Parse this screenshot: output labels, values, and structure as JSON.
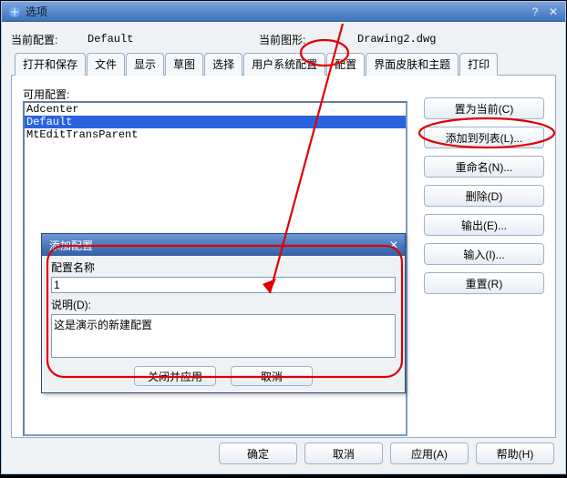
{
  "window": {
    "title": "选项",
    "help_glyph": "?",
    "close_glyph": "✕"
  },
  "info": {
    "current_profile_label": "当前配置:",
    "current_profile_value": "Default",
    "current_drawing_label": "当前图形:",
    "current_drawing_value": "Drawing2.dwg"
  },
  "tabs": {
    "items": [
      {
        "label": "打开和保存"
      },
      {
        "label": "文件"
      },
      {
        "label": "显示"
      },
      {
        "label": "草图"
      },
      {
        "label": "选择"
      },
      {
        "label": "用户系统配置"
      },
      {
        "label": "配置"
      },
      {
        "label": "界面皮肤和主题"
      },
      {
        "label": "打印"
      }
    ],
    "active_index": 6
  },
  "page": {
    "available_label": "可用配置:",
    "list": [
      "Adcenter",
      "Default",
      "MtEditTransParent"
    ],
    "selected_index": 1
  },
  "buttons": {
    "set_current": "置为当前(C)",
    "add_to_list": "添加到列表(L)...",
    "rename": "重命名(N)...",
    "delete": "删除(D)",
    "export": "输出(E)...",
    "import": "输入(I)...",
    "reset": "重置(R)"
  },
  "footer": {
    "ok": "确定",
    "cancel": "取消",
    "apply": "应用(A)",
    "help": "帮助(H)"
  },
  "modal": {
    "title": "添加配置",
    "name_label": "配置名称",
    "name_value": "1",
    "desc_label": "说明(D):",
    "desc_value": "这是演示的新建配置",
    "close_apply": "关闭并应用",
    "cancel": "取消"
  }
}
